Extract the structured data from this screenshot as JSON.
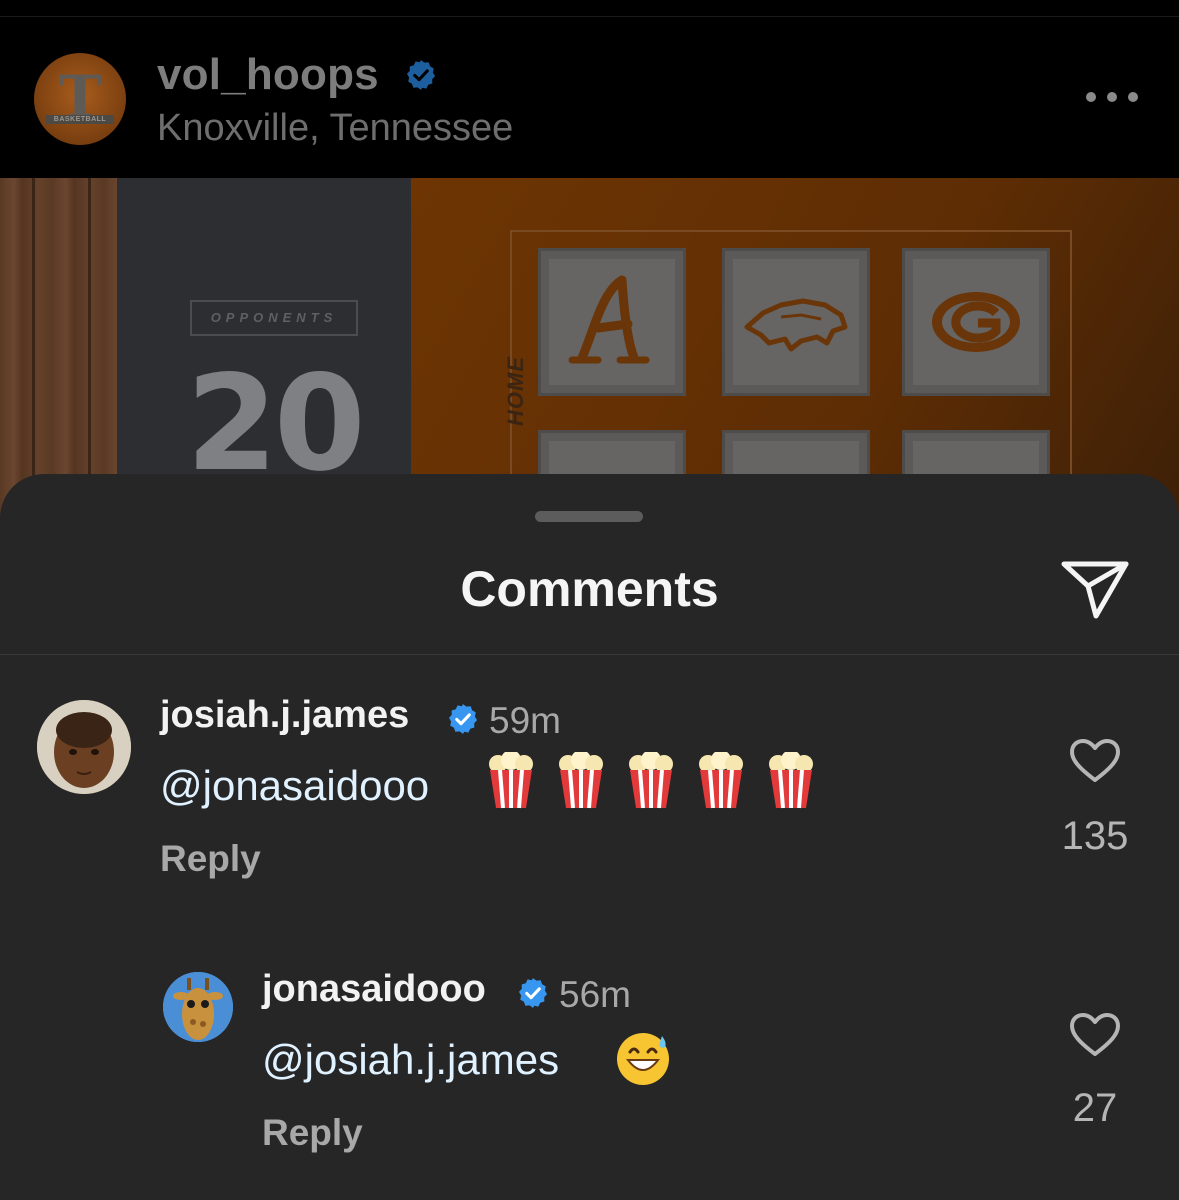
{
  "post": {
    "username": "vol_hoops",
    "location": "Knoxville, Tennessee",
    "avatar_letter": "T",
    "avatar_banner": "BASKETBALL",
    "verified_icon": "verified-badge-icon",
    "more_icon": "more-options-icon"
  },
  "media": {
    "opponents_label": "OPPONENTS",
    "opponents_count": "20",
    "home_label": "HOME",
    "tile_logos": [
      "alabama-logo",
      "arkansas-razorback-logo",
      "georgia-logo"
    ]
  },
  "comments_sheet": {
    "title": "Comments",
    "share_icon": "send-icon",
    "comments": [
      {
        "username": "josiah.j.james",
        "time": "59m",
        "mention": "@jonasaidooo",
        "emoji": "🍿🍿🍿🍿🍿",
        "reply_label": "Reply",
        "likes": "135"
      },
      {
        "username": "jonasaidooo",
        "time": "56m",
        "mention": "@josiah.j.james",
        "emoji": "😅",
        "reply_label": "Reply",
        "likes": "27"
      }
    ]
  },
  "colors": {
    "sheet_bg": "#262626",
    "verified_blue": "#3797f0",
    "mention": "#e0f1ff",
    "muted_text": "#a8a8a8"
  }
}
